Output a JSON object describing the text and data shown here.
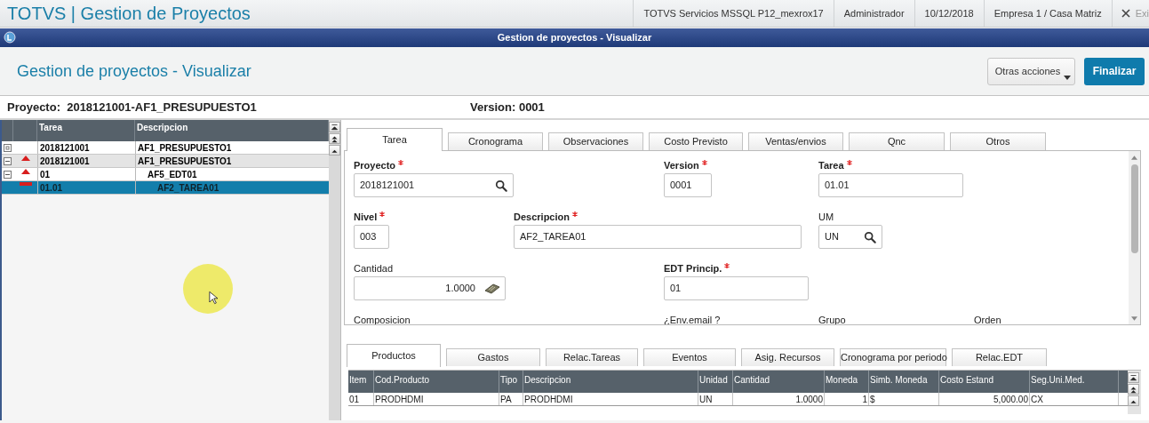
{
  "app_title": "TOTVS | Gestion de Proyectos",
  "session": [
    "TOTVS Servicios MSSQL P12_mexrox17",
    "Administrador",
    "10/12/2018",
    "Empresa 1 / Casa Matriz"
  ],
  "exit_label": "Exi",
  "window": {
    "title": "Gestion de proyectos - Visualizar"
  },
  "header": {
    "title": "Gestion de proyectos - Visualizar",
    "buttons": [
      {
        "label": "Otras acciones",
        "kind": "menu"
      },
      {
        "label": "Finalizar",
        "kind": "primary"
      }
    ]
  },
  "project_line": {
    "proyecto": "Proyecto:  2018121001-AF1_PRESUPUESTO1",
    "version": "Version: 0001"
  },
  "tree": {
    "columns": [
      "Tarea",
      "Descripcion"
    ],
    "rows": [
      {
        "kind": "root",
        "tarea": "2018121001",
        "descripcion": "AF1_PRESUPUESTO1",
        "selected": false,
        "children": [
          {
            "kind": "edt",
            "tarea": "2018121001",
            "descripcion": "AF1_PRESUPUESTO1",
            "selected": false,
            "children": [
              {
                "kind": "edt",
                "tarea": "01",
                "descripcion": "AF5_EDT01",
                "selected": false,
                "children": [
                  {
                    "kind": "task",
                    "tarea": "01.01",
                    "descripcion": "AF2_TAREA01",
                    "selected": true
                  }
                ]
              }
            ]
          }
        ]
      }
    ]
  },
  "tabs": [
    {
      "label": "Tarea",
      "selected": true
    },
    {
      "label": "Cronograma",
      "selected": false
    },
    {
      "label": "Observaciones",
      "selected": false
    },
    {
      "label": "Costo Previsto",
      "selected": false
    },
    {
      "label": "Ventas/envios",
      "selected": false
    },
    {
      "label": "Qnc",
      "selected": false
    },
    {
      "label": "Otros",
      "selected": false
    }
  ],
  "form_rows": [
    [
      {
        "label": "Proyecto",
        "required": true,
        "kind": "lookup",
        "value": "2018121001"
      },
      {
        "label": "Version",
        "required": true,
        "kind": "text",
        "value": "0001"
      },
      {
        "label": "Tarea",
        "required": true,
        "kind": "text",
        "value": "01.01"
      }
    ],
    [
      {
        "label": "Nivel",
        "required": true,
        "kind": "text",
        "value": "003"
      },
      {
        "label": "Descripcion",
        "required": true,
        "kind": "text",
        "value": "AF2_TAREA01"
      },
      {
        "label": "UM",
        "required": false,
        "kind": "lookup",
        "value": "UN"
      }
    ],
    [
      {
        "label": "Cantidad",
        "required": false,
        "kind": "number",
        "value": "1.0000"
      },
      {
        "label": "EDT Princip.",
        "required": true,
        "kind": "text",
        "value": "01"
      }
    ],
    [
      {
        "label": "Composicion",
        "required": false,
        "kind": "label"
      },
      {
        "label": "¿Env.email ?",
        "required": false,
        "kind": "label"
      },
      {
        "label": "Grupo",
        "required": false,
        "kind": "label"
      },
      {
        "label": "Orden",
        "required": false,
        "kind": "label"
      }
    ]
  ],
  "detail_tabs": [
    {
      "label": "Productos",
      "selected": true
    },
    {
      "label": "Gastos",
      "selected": false
    },
    {
      "label": "Relac.Tareas",
      "selected": false
    },
    {
      "label": "Eventos",
      "selected": false
    },
    {
      "label": "Asig. Recursos",
      "selected": false
    },
    {
      "label": "Cronograma por periodo",
      "selected": false
    },
    {
      "label": "Relac.EDT",
      "selected": false
    }
  ],
  "grid": {
    "columns": [
      "Item",
      "Cod.Producto",
      "Tipo",
      "Descripcion",
      "Unidad",
      "Cantidad",
      "Moneda",
      "Simb. Moneda",
      "Costo Estand",
      "Seg.Uni.Med."
    ],
    "rows": [
      [
        "01",
        "PRODHDMI",
        "PA",
        "PRODHDMI",
        "UN",
        "1.0000",
        "1",
        "$",
        "5,000.00",
        "CX"
      ]
    ]
  }
}
